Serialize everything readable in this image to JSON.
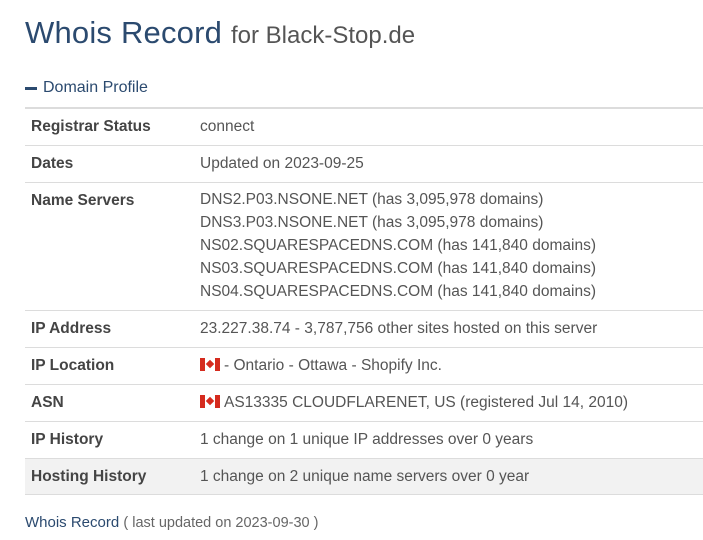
{
  "header": {
    "title_main": "Whois Record",
    "title_sub": "for Black-Stop.de"
  },
  "section": {
    "label": "Domain Profile",
    "icon": "minus-icon"
  },
  "rows": {
    "registrar_status": {
      "label": "Registrar Status",
      "value": "connect"
    },
    "dates": {
      "label": "Dates",
      "value": "Updated on 2023-09-25"
    },
    "name_servers": {
      "label": "Name Servers",
      "values": [
        "DNS2.P03.NSONE.NET (has 3,095,978 domains)",
        "DNS3.P03.NSONE.NET (has 3,095,978 domains)",
        "NS02.SQUARESPACEDNS.COM (has 141,840 domains)",
        "NS03.SQUARESPACEDNS.COM (has 141,840 domains)",
        "NS04.SQUARESPACEDNS.COM (has 141,840 domains)"
      ]
    },
    "ip_address": {
      "label": "IP Address",
      "value": "23.227.38.74 - 3,787,756 other sites hosted on this server"
    },
    "ip_location": {
      "label": "IP Location",
      "flag_icon": "canada-flag-icon",
      "value": "- Ontario - Ottawa - Shopify Inc."
    },
    "asn": {
      "label": "ASN",
      "flag_icon": "canada-flag-icon",
      "value": "AS13335 CLOUDFLARENET, US (registered Jul 14, 2010)"
    },
    "ip_history": {
      "label": "IP History",
      "value": "1 change on 1 unique IP addresses over 0 years"
    },
    "hosting_history": {
      "label": "Hosting History",
      "value": "1 change on 2 unique name servers over 0 year"
    }
  },
  "footer": {
    "link": "Whois Record",
    "note": "( last updated on 2023-09-30 )"
  },
  "colors": {
    "heading": "#2b4a6f",
    "text": "#555555",
    "border": "#dcdcdc",
    "shaded_row": "#f2f2f2"
  }
}
